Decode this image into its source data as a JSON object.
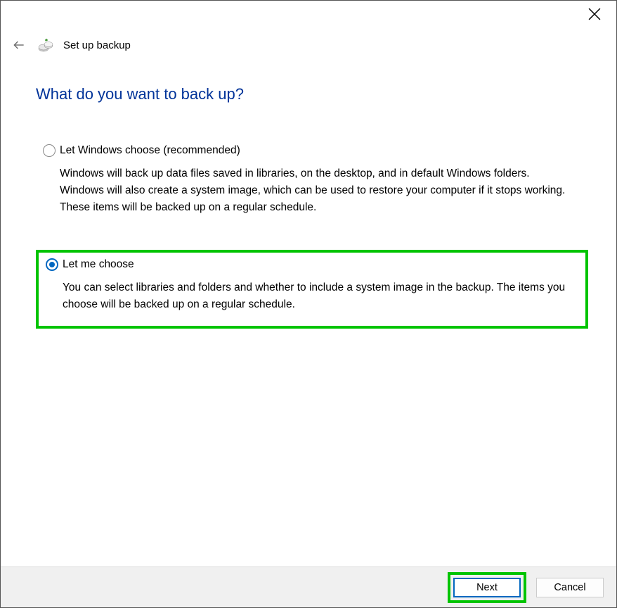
{
  "window": {
    "title": "Set up backup"
  },
  "page": {
    "heading": "What do you want to back up?"
  },
  "options": {
    "windows_choose": {
      "label": "Let Windows choose (recommended)",
      "description": "Windows will back up data files saved in libraries, on the desktop, and in default Windows folders. Windows will also create a system image, which can be used to restore your computer if it stops working. These items will be backed up on a regular schedule.",
      "selected": false
    },
    "let_me_choose": {
      "label": "Let me choose",
      "description": "You can select libraries and folders and whether to include a system image in the backup. The items you choose will be backed up on a regular schedule.",
      "selected": true
    }
  },
  "footer": {
    "next_label": "Next",
    "cancel_label": "Cancel"
  }
}
